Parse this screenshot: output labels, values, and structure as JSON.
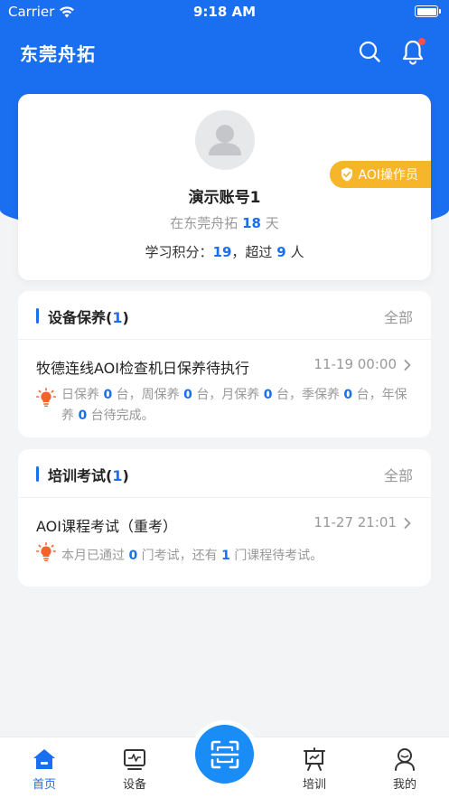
{
  "status_bar": {
    "carrier": "Carrier",
    "time": "9:18 AM"
  },
  "nav": {
    "title": "东莞舟拓"
  },
  "profile": {
    "role": "AOI操作员",
    "name": "演示账号1",
    "days_prefix": "在东莞舟拓",
    "days_value": "18",
    "days_suffix": "天",
    "points_prefix": "学习积分：",
    "points_value": "19",
    "points_mid": "，超过",
    "rank_value": "9",
    "rank_suffix": "人"
  },
  "maintenance": {
    "title": "设备保养(",
    "count": "1",
    "title_end": ")",
    "all_label": "全部",
    "task": {
      "title": "牧德连线AOI检查机日保养待执行",
      "time": "11-19 00:00",
      "desc": {
        "p1": "日保养",
        "v1": "0",
        "p2": "台，周保养",
        "v2": "0",
        "p3": "台，月保养",
        "v3": "0",
        "p4": "台，季保养",
        "v4": "0",
        "p5": "台，年保养",
        "v5": "0",
        "p6": "台待完成。"
      }
    }
  },
  "training": {
    "title": "培训考试(",
    "count": "1",
    "title_end": ")",
    "all_label": "全部",
    "task": {
      "title": "AOI课程考试（重考）",
      "time": "11-27 21:01",
      "desc": {
        "p1": "本月已通过",
        "v1": "0",
        "p2": "门考试，还有",
        "v2": "1",
        "p3": "门课程待考试。"
      }
    }
  },
  "tabbar": {
    "items": [
      {
        "label": "首页"
      },
      {
        "label": "设备"
      },
      {
        "label": "培训"
      },
      {
        "label": "我的"
      }
    ]
  },
  "colors": {
    "primary": "#1a6ff0",
    "badge": "#f7b52a",
    "bulb": "#f5632a",
    "alert_dot": "#ff4d4f"
  }
}
